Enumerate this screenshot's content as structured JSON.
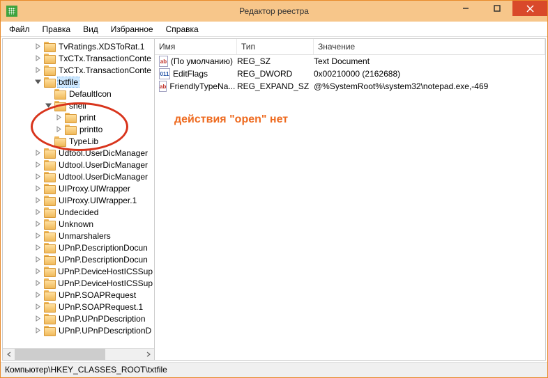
{
  "window": {
    "title": "Редактор реестра"
  },
  "menu": [
    "Файл",
    "Правка",
    "Вид",
    "Избранное",
    "Справка"
  ],
  "tree": [
    {
      "indent": 45,
      "exp": "closed",
      "label": "TvRatings.XDSToRat.1"
    },
    {
      "indent": 45,
      "exp": "closed",
      "label": "TxCTx.TransactionConte"
    },
    {
      "indent": 45,
      "exp": "closed",
      "label": "TxCTx.TransactionConte"
    },
    {
      "indent": 45,
      "exp": "open",
      "label": "txtfile",
      "selected": true
    },
    {
      "indent": 60,
      "exp": "none",
      "label": "DefaultIcon"
    },
    {
      "indent": 60,
      "exp": "open",
      "label": "shell"
    },
    {
      "indent": 75,
      "exp": "closed",
      "label": "print"
    },
    {
      "indent": 75,
      "exp": "closed",
      "label": "printto"
    },
    {
      "indent": 60,
      "exp": "none",
      "label": "TypeLib"
    },
    {
      "indent": 45,
      "exp": "closed",
      "label": "Udtool.UserDicManager"
    },
    {
      "indent": 45,
      "exp": "closed",
      "label": "Udtool.UserDicManager"
    },
    {
      "indent": 45,
      "exp": "closed",
      "label": "Udtool.UserDicManager"
    },
    {
      "indent": 45,
      "exp": "closed",
      "label": "UIProxy.UIWrapper"
    },
    {
      "indent": 45,
      "exp": "closed",
      "label": "UIProxy.UIWrapper.1"
    },
    {
      "indent": 45,
      "exp": "closed",
      "label": "Undecided"
    },
    {
      "indent": 45,
      "exp": "closed",
      "label": "Unknown"
    },
    {
      "indent": 45,
      "exp": "closed",
      "label": "Unmarshalers"
    },
    {
      "indent": 45,
      "exp": "closed",
      "label": "UPnP.DescriptionDocun"
    },
    {
      "indent": 45,
      "exp": "closed",
      "label": "UPnP.DescriptionDocun"
    },
    {
      "indent": 45,
      "exp": "closed",
      "label": "UPnP.DeviceHostICSSup"
    },
    {
      "indent": 45,
      "exp": "closed",
      "label": "UPnP.DeviceHostICSSup"
    },
    {
      "indent": 45,
      "exp": "closed",
      "label": "UPnP.SOAPRequest"
    },
    {
      "indent": 45,
      "exp": "closed",
      "label": "UPnP.SOAPRequest.1"
    },
    {
      "indent": 45,
      "exp": "closed",
      "label": "UPnP.UPnPDescription"
    },
    {
      "indent": 45,
      "exp": "closed",
      "label": "UPnP.UPnPDescriptionD"
    }
  ],
  "columns": [
    "Имя",
    "Тип",
    "Значение"
  ],
  "values": [
    {
      "icon": "str",
      "name": "(По умолчанию)",
      "type": "REG_SZ",
      "data": "Text Document"
    },
    {
      "icon": "bin",
      "name": "EditFlags",
      "type": "REG_DWORD",
      "data": "0x00210000 (2162688)"
    },
    {
      "icon": "str",
      "name": "FriendlyTypeNa...",
      "type": "REG_EXPAND_SZ",
      "data": "@%SystemRoot%\\system32\\notepad.exe,-469"
    }
  ],
  "annotation": "действия \"open\" нет",
  "statusbar": "Компьютер\\HKEY_CLASSES_ROOT\\txtfile",
  "icons": {
    "ab": "ab",
    "bin": "011"
  }
}
